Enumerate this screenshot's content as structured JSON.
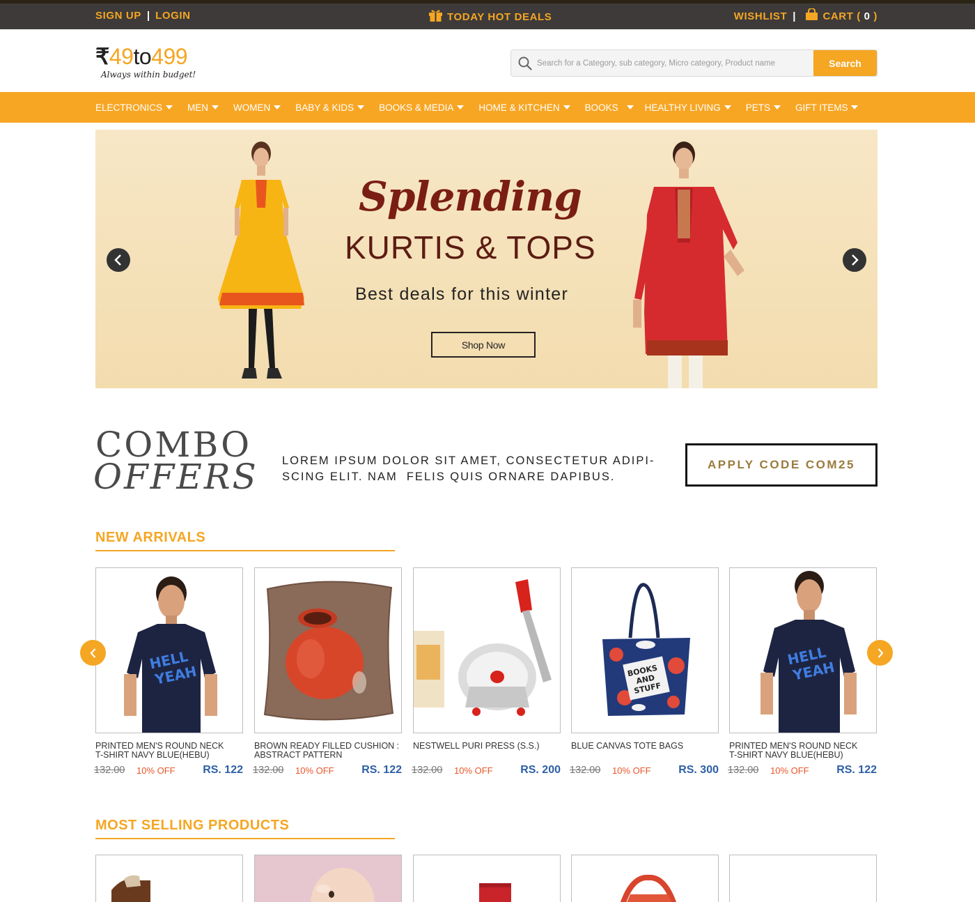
{
  "topbar": {
    "signup": "SIGN UP",
    "separator": "|",
    "login": "LOGIN",
    "deals": "TODAY HOT DEALS",
    "wishlist": "WISHLIST",
    "cart_label": "CART (",
    "cart_count": "0",
    "cart_close": ")"
  },
  "logo": {
    "rupee": "₹",
    "part1": "49",
    "part2": "to",
    "part3": "499",
    "tagline": "Always within budget!"
  },
  "search": {
    "placeholder": "Search for a Category, sub category, Micro category, Product name",
    "button": "Search"
  },
  "nav": {
    "items": [
      "ELECTRONICS",
      "MEN",
      "WOMEN",
      "BABY & KIDS",
      "BOOKS & MEDIA",
      "HOME & KITCHEN",
      "BOOKS",
      "HEALTHY LIVING",
      "PETS",
      "GIFT ITEMS"
    ]
  },
  "hero": {
    "script": "Splending",
    "title": "KURTIS & TOPS",
    "subtitle": "Best deals for this winter",
    "button": "Shop Now"
  },
  "combo": {
    "title_line1": "COMBO",
    "title_line2": "OFFERS",
    "text_line1": "Lorem ipsum dolor sit amet, consectetur adipi-",
    "text_line2": "scing elit. Nam  felis quis ornare dapibus.",
    "button": "APPLY CODE COM25"
  },
  "new_arrivals": {
    "heading": "NEW ARRIVALS",
    "products": [
      {
        "name_line1": "PRINTED MEN'S ROUND NECK",
        "name_line2": "T-SHIRT NAVY BLUE(HEBU)",
        "old_price": "132.00",
        "discount": "10% OFF",
        "price": "RS. 122"
      },
      {
        "name_line1": "BROWN READY FILLED CUSHION :",
        "name_line2": "ABSTRACT PATTERN",
        "old_price": "132.00",
        "discount": "10% OFF",
        "price": "RS. 122"
      },
      {
        "name_line1": "NESTWELL PURI PRESS (S.S.)",
        "name_line2": "",
        "old_price": "132.00",
        "discount": "10% OFF",
        "price": "RS. 200"
      },
      {
        "name_line1": "BLUE CANVAS TOTE BAGS",
        "name_line2": "",
        "old_price": "132.00",
        "discount": "10% OFF",
        "price": "RS. 300"
      },
      {
        "name_line1": "PRINTED MEN'S ROUND NECK",
        "name_line2": "T-SHIRT NAVY BLUE(HEBU)",
        "old_price": "132.00",
        "discount": "10% OFF",
        "price": "RS. 122"
      }
    ],
    "tshirt_print_line1": "HELL",
    "tshirt_print_line2": "YEAH",
    "bag_print_line1": "BOOKS",
    "bag_print_line2": "AND",
    "bag_print_line3": "STUFF"
  },
  "most_selling": {
    "heading": "MOST SELLING PRODUCTS"
  },
  "colors": {
    "accent": "#f5a623",
    "topbar": "#3d3a39",
    "price": "#2d5fa6",
    "discount": "#e8562a"
  }
}
